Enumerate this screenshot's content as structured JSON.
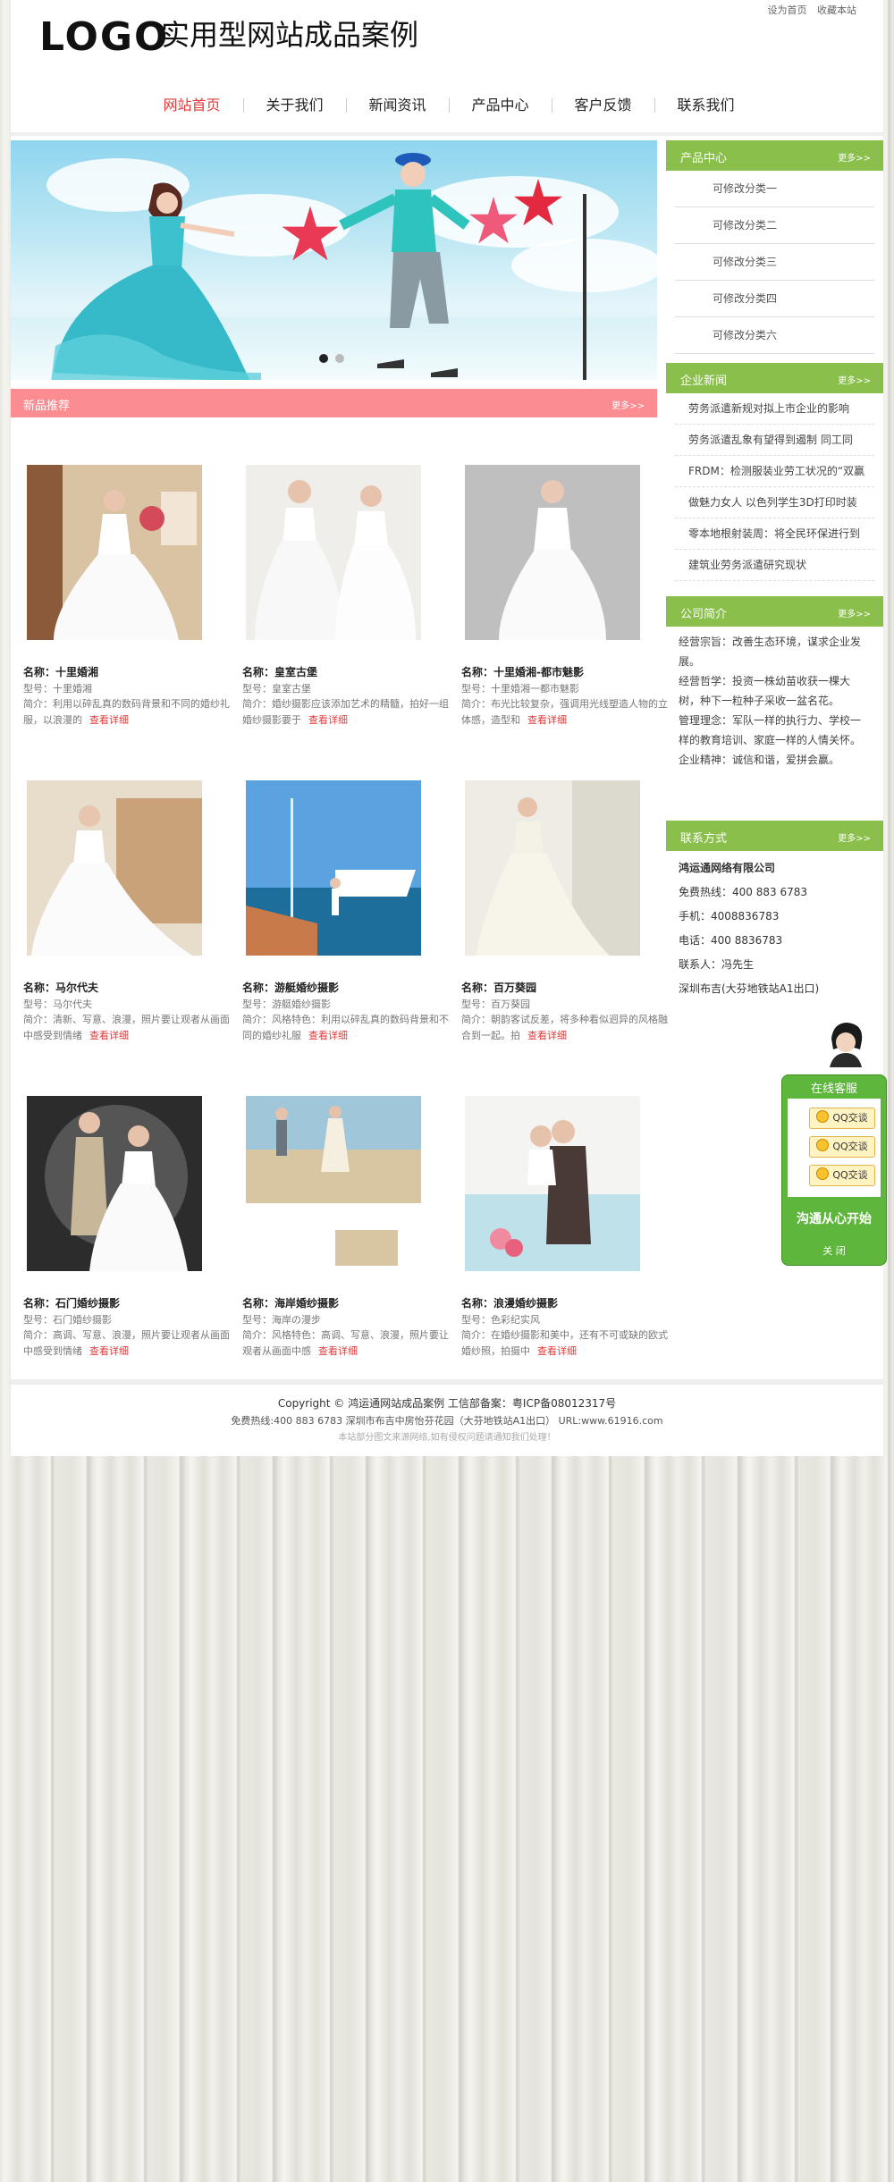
{
  "header": {
    "logo": "LOGO",
    "site_title": "实用型网站成品案例",
    "top_links": [
      "设为首页",
      "收藏本站"
    ]
  },
  "nav": [
    "网站首页",
    "关于我们",
    "新闻资讯",
    "产品中心",
    "客户反馈",
    "联系我们"
  ],
  "colors": {
    "accent_red": "#e33a3a",
    "pink_bar": "#fb8d92",
    "green_bar": "#8abf4c"
  },
  "new_products": {
    "title": "新品推荐",
    "more": "更多>>",
    "items": [
      {
        "name_label": "名称：",
        "name": "十里婚湘",
        "type": "型号：十里婚湘",
        "desc": "简介：利用以碎乱真的数码背景和不同的婚纱礼服，以浪漫的",
        "more": "查看详细"
      },
      {
        "name_label": "名称：",
        "name": "皇室古堡",
        "type": "型号：皇室古堡",
        "desc": "简介：婚纱摄影应该添加艺术的精髓，拍好一组婚纱摄影要于",
        "more": "查看详细"
      },
      {
        "name_label": "名称：",
        "name": "十里婚湘-都市魅影",
        "type": "型号：十里婚湘一都市魅影",
        "desc": "简介：布光比较复杂，强调用光线塑造人物的立体感，造型和",
        "more": "查看详细"
      },
      {
        "name_label": "名称：",
        "name": "马尔代夫",
        "type": "型号：马尔代夫",
        "desc": "简介：清新、写意、浪漫，照片要让观者从画面中感受到情绪",
        "more": "查看详细"
      },
      {
        "name_label": "名称：",
        "name": "游艇婚纱摄影",
        "type": "型号：游艇婚纱摄影",
        "desc": "简介：风格特色：利用以碎乱真的数码背景和不同的婚纱礼服",
        "more": "查看详细"
      },
      {
        "name_label": "名称：",
        "name": "百万葵园",
        "type": "型号：百万葵园",
        "desc": "简介：朝韵客试反差，将多种看似迥异的风格融合到一起。拍",
        "more": "查看详细"
      },
      {
        "name_label": "名称：",
        "name": "石门婚纱摄影",
        "type": "型号：石门婚纱摄影",
        "desc": "简介：高调、写意、浪漫，照片要让观者从画面中感受到情绪",
        "more": "查看详细"
      },
      {
        "name_label": "名称：",
        "name": "海岸婚纱摄影",
        "type": "型号：海岸の漫步",
        "desc": "简介：风格特色：高调、写意、浪漫，照片要让观者从画面中感",
        "more": "查看详细"
      },
      {
        "name_label": "名称：",
        "name": "浪漫婚纱摄影",
        "type": "型号：色彩纪实风",
        "desc": "简介：在婚纱摄影和美中，还有不可或缺的欧式婚纱照，拍摄中",
        "more": "查看详细"
      }
    ]
  },
  "sidebar": {
    "product_center": {
      "title": "产品中心",
      "more": "更多>>",
      "items": [
        "可修改分类一",
        "可修改分类二",
        "可修改分类三",
        "可修改分类四",
        "可修改分类六"
      ]
    },
    "company_news": {
      "title": "企业新闻",
      "more": "更多>>",
      "items": [
        "劳务派遣新规对拟上市企业的影响",
        "劳务派遣乱象有望得到遏制 同工同",
        "FRDM：检测服装业劳工状况的“双赢",
        "做魅力女人 以色列学生3D打印时装",
        "零本地根射装周：将全民环保进行到",
        "建筑业劳务派遣研究现状"
      ]
    },
    "company_intro": {
      "title": "公司简介",
      "more": "更多>>",
      "lines": [
        "经营宗旨：改善生态环境，谋求企业发展。",
        "经营哲学：投资一株幼苗收获一棵大树，种下一粒种子采收一盆名花。",
        "管理理念：军队一样的执行力、学校一样的教育培训、家庭一样的人情关怀。",
        "企业精神：诚信和谐，爱拼会赢。"
      ]
    },
    "contact": {
      "title": "联系方式",
      "more": "更多>>",
      "company": "鸿运通网络有限公司",
      "hotline": "免费热线：400 883 6783",
      "mobile": "手机：4008836783",
      "phone": "电话：400 8836783",
      "person": "联系人：冯先生",
      "address": "深圳布吉(大芬地铁站A1出口)"
    }
  },
  "chat": {
    "title": "在线客服",
    "qq_buttons": [
      "QQ交谈",
      "QQ交谈",
      "QQ交谈"
    ],
    "slogan": "沟通从心开始",
    "close": "关 闭"
  },
  "footer": {
    "copyright": "Copyright © 鸿运通网站成品案例 工信部备案：粤ICP备08012317号",
    "contact_line": "免费热线:400 883 6783 深圳市布吉中房怡芬花园（大芬地铁站A1出口） URL:www.61916.com",
    "notice": "本站部分图文来源网络,如有侵权问题请通知我们处理！"
  }
}
